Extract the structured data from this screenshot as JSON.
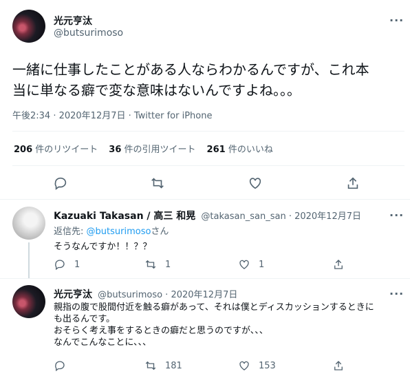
{
  "main_tweet": {
    "display_name": "光元亨汰",
    "handle": "@butsurimoso",
    "text_line1": "一緒に仕事したことがある人ならわかるんですが、これ本",
    "text_line2": "当に単なる癖で変な意味はないんですよね。。。",
    "meta": "午後2:34 · 2020年12月7日 · Twitter for iPhone",
    "retweets_count": "206",
    "retweets_label": "件のリツイート",
    "quotes_count": "36",
    "quotes_label": "件の引用ツイート",
    "likes_count": "261",
    "likes_label": "件のいいね",
    "more": "···"
  },
  "reply1": {
    "display_name": "Kazuaki Takasan / 高三 和晃",
    "handle_date": "@takasan_san_san · 2020年12月7日",
    "reply_prefix": "返信先: ",
    "reply_to": "@butsurimoso",
    "reply_suffix": "さん",
    "text": "そうなんですか！！？？",
    "replies": "1",
    "retweets": "1",
    "likes": "1",
    "more": "···"
  },
  "reply2": {
    "display_name": "光元亨汰",
    "handle_date": "@butsurimoso · 2020年12月7日",
    "text_line1": "親指の腹で股間付近を触る癖があって、それは僕とディスカッションするときに",
    "text_line2": "も出るんです。",
    "text_line3": "おそらく考え事をするときの癖だと思うのですが、、、",
    "text_line4": "なんでこんなことに、、、",
    "retweets": "181",
    "likes": "153",
    "more": "···"
  },
  "icons": [
    "reply-icon",
    "retweet-icon",
    "like-icon",
    "share-icon",
    "more-icon"
  ],
  "colors": {
    "link": "#1d9bf0",
    "muted": "#536471",
    "text": "#0f1419",
    "divider": "#eff3f4"
  }
}
